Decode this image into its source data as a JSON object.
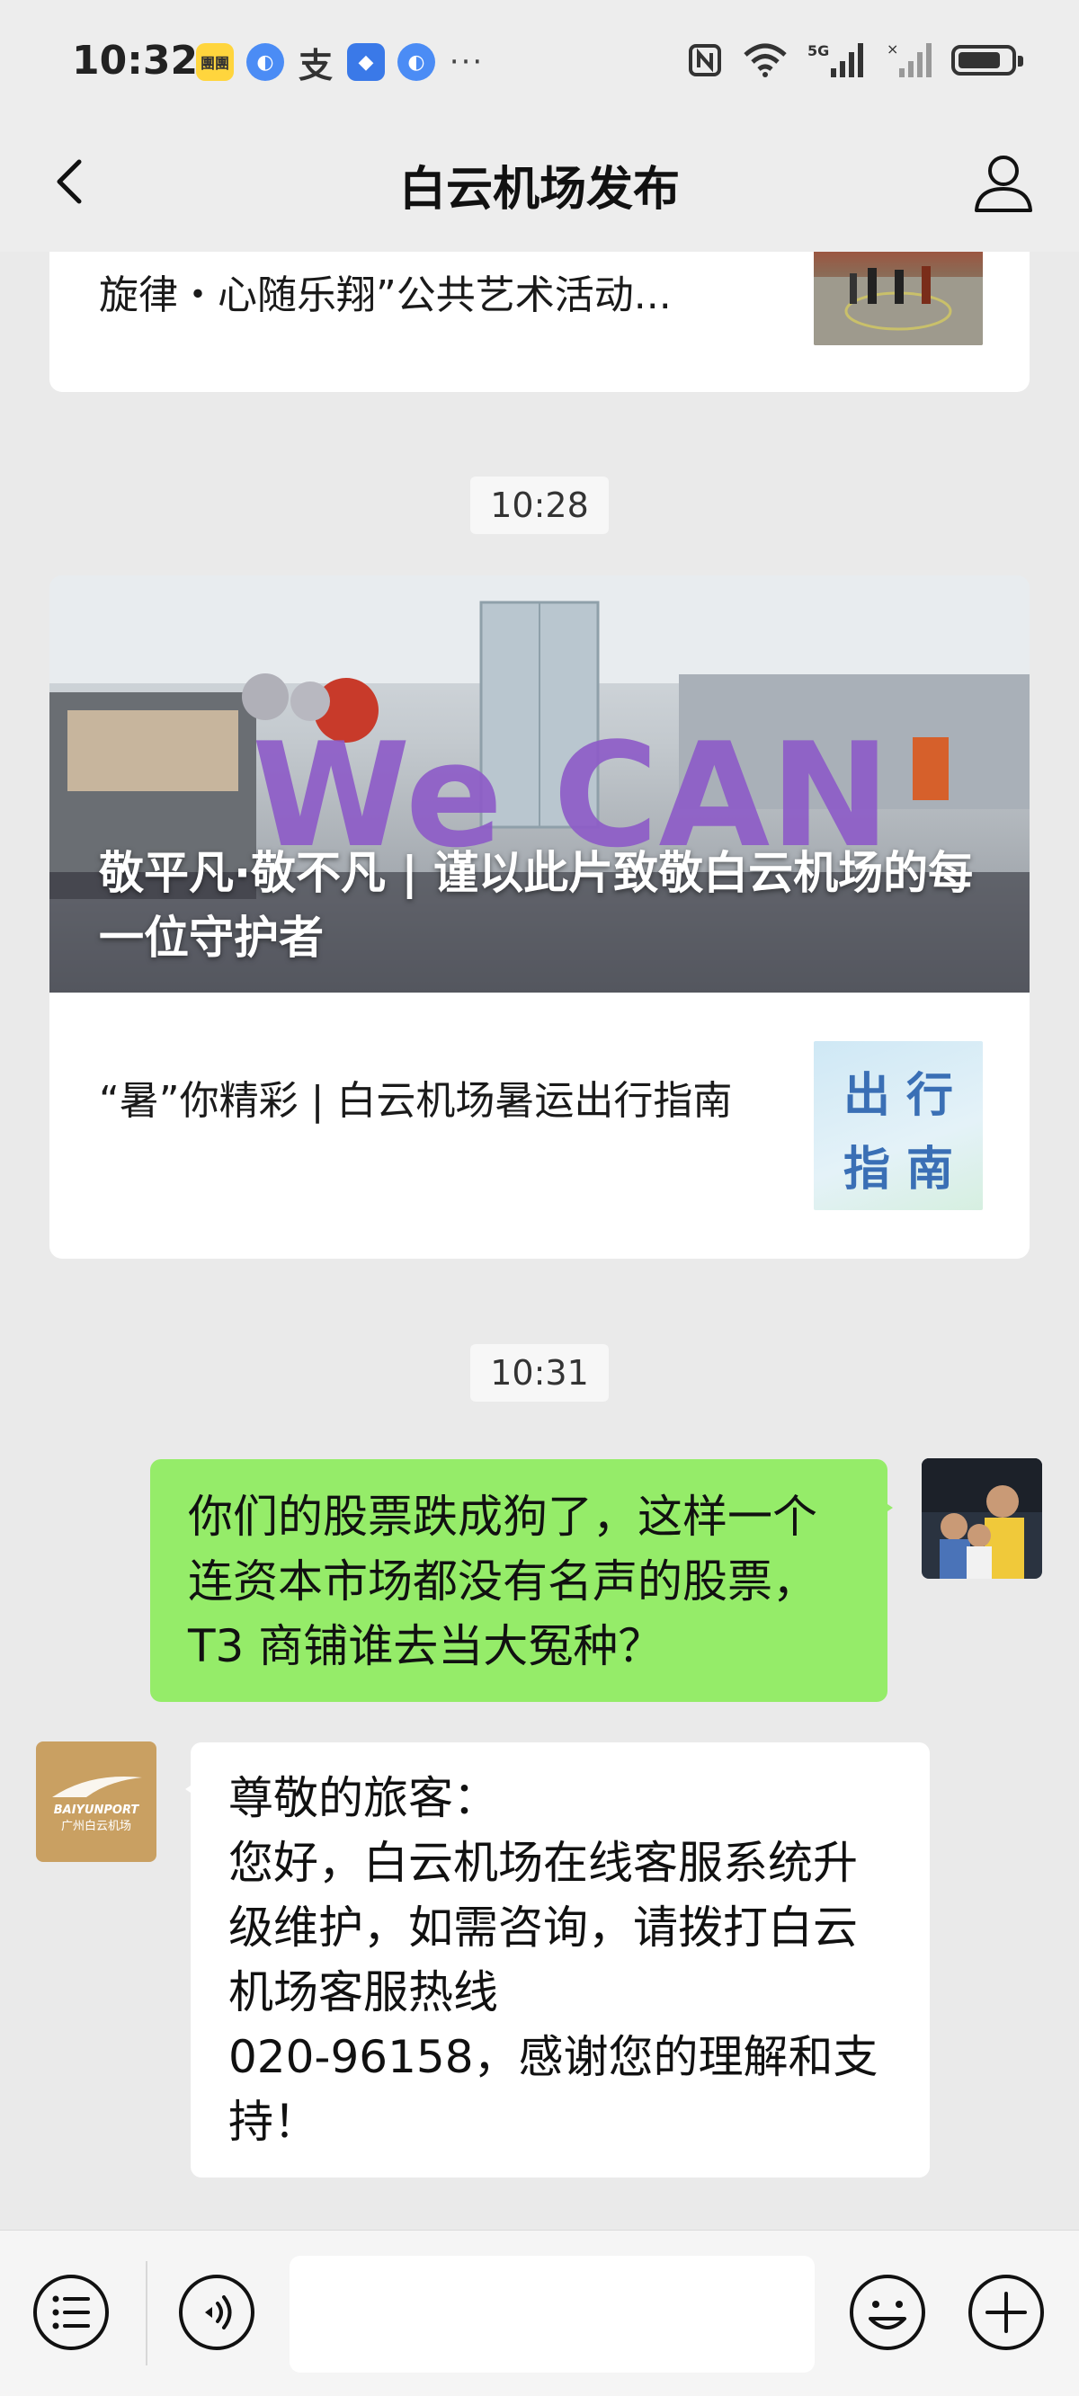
{
  "status_bar": {
    "time": "10:32",
    "notif_icons": [
      "app-badge-icon",
      "browser-icon",
      "alipay-icon",
      "security-icon",
      "browser-icon",
      "more-icon"
    ],
    "zhi_char": "支",
    "app_badge_text": "團團",
    "dots": "···",
    "network": "5G",
    "battery_level": 0.82
  },
  "nav": {
    "title": "白云机场发布"
  },
  "chat": {
    "card1": {
      "item_title": "旋律・心随乐翔”公共艺术活动..."
    },
    "timestamp1": "10:28",
    "card2": {
      "hero_title": "敬平凡·敬不凡 | 谨以此片致敬白云机场的每一位守护者",
      "hero_sign": "We CAN",
      "item_title": "“暑”你精彩 | 白云机场暑运出行指南",
      "thumb_text_line1": "出 行",
      "thumb_text_line2": "指 南"
    },
    "timestamp2": "10:31",
    "outgoing_message": "你们的股票跌成狗了，这样一个连资本市场都没有名声的股票，T3 商铺谁去当大冤种？",
    "incoming_message": "尊敬的旅客：\n您好，白云机场在线客服系统升级维护，如需咨询，请拨打白云机场客服热线\n020-96158，感谢您的理解和支持！",
    "bot_logo_line1": "BAIYUNPORT",
    "bot_logo_line2": "广州白云机场"
  },
  "colors": {
    "outgoing_bubble": "#95ec69",
    "background": "#ededed",
    "bot_logo": "#c9a062"
  }
}
